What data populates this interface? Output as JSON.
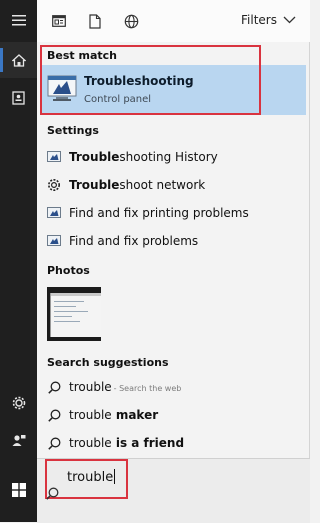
{
  "toolbar": {
    "icons": [
      "apps-icon",
      "document-icon",
      "web-globe-icon"
    ],
    "filters_label": "Filters"
  },
  "sidebar": {
    "icons": [
      "home-icon",
      "notebook-icon",
      "settings-icon",
      "user-feedback-icon",
      "windows-start-icon"
    ]
  },
  "best_match": {
    "heading": "Best match",
    "title_bold": "Trouble",
    "title_rest": "shooting",
    "subtitle": "Control panel"
  },
  "settings": {
    "heading": "Settings",
    "items": [
      {
        "bold": "Trouble",
        "rest": "shooting History",
        "icon": "control-panel-icon"
      },
      {
        "bold": "Trouble",
        "rest": "shoot network",
        "icon": "network-gear-icon"
      },
      {
        "bold": "",
        "rest": "Find and fix printing problems",
        "icon": "control-panel-icon"
      },
      {
        "bold": "",
        "rest": "Find and fix problems",
        "icon": "control-panel-icon"
      }
    ]
  },
  "photos": {
    "heading": "Photos"
  },
  "suggestions": {
    "heading": "Search suggestions",
    "items": [
      {
        "text": "trouble",
        "bold_suffix": "",
        "muted": "- Search the web"
      },
      {
        "text": "trouble",
        "bold_suffix": " maker",
        "muted": ""
      },
      {
        "text": "trouble",
        "bold_suffix": " is a friend",
        "muted": ""
      }
    ]
  },
  "search": {
    "value": "trouble"
  },
  "colors": {
    "accent_highlight": "#b9d6f0",
    "annotation_red": "#d9333f",
    "taskbar": "#1f1f1f"
  }
}
